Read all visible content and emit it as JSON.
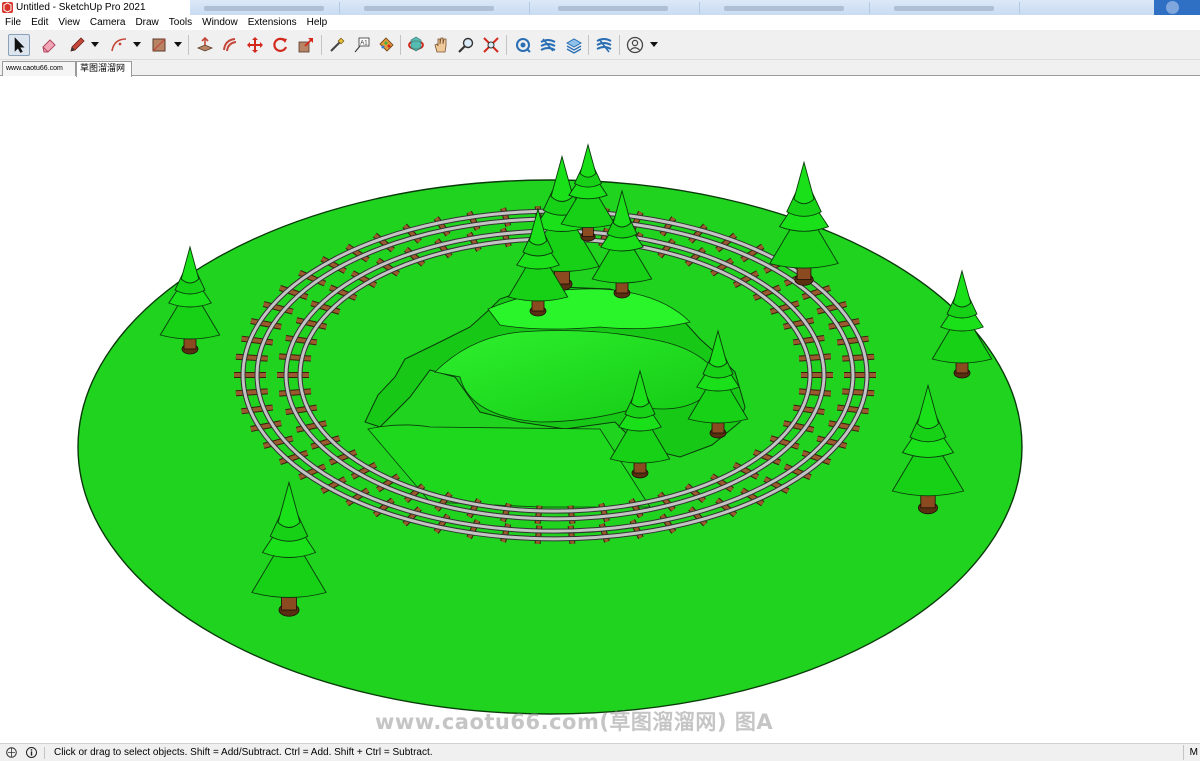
{
  "window": {
    "title": "Untitled - SketchUp Pro 2021"
  },
  "menu": [
    "File",
    "Edit",
    "View",
    "Camera",
    "Draw",
    "Tools",
    "Window",
    "Extensions",
    "Help"
  ],
  "toolbar": {
    "tools": [
      {
        "name": "select-tool",
        "icon": "arrow-cursor-icon",
        "selected": true
      },
      {
        "name": "eraser-tool",
        "icon": "eraser-icon"
      },
      {
        "name": "line-tool",
        "icon": "pencil-icon",
        "dropdown": true
      },
      {
        "name": "arc-tool",
        "icon": "arc-icon",
        "dropdown": true
      },
      {
        "name": "shape-tool",
        "icon": "rectangle-icon",
        "dropdown": true
      },
      {
        "name": "push-pull-tool",
        "icon": "push-pull-icon"
      },
      {
        "name": "offset-tool",
        "icon": "offset-icon"
      },
      {
        "name": "move-tool",
        "icon": "move-icon"
      },
      {
        "name": "rotate-tool",
        "icon": "rotate-icon"
      },
      {
        "name": "scale-tool",
        "icon": "scale-icon"
      },
      {
        "name": "tape-measure-tool",
        "icon": "tape-measure-icon"
      },
      {
        "name": "text-tool",
        "icon": "text-icon"
      },
      {
        "name": "paint-bucket-tool",
        "icon": "paint-bucket-icon"
      },
      {
        "name": "orbit-tool",
        "icon": "orbit-icon"
      },
      {
        "name": "pan-tool",
        "icon": "hand-icon"
      },
      {
        "name": "zoom-tool",
        "icon": "magnifier-icon"
      },
      {
        "name": "zoom-extents-tool",
        "icon": "zoom-extents-icon"
      },
      {
        "name": "warehouse-tool",
        "icon": "warehouse-icon"
      },
      {
        "name": "extension-warehouse-tool",
        "icon": "extension-warehouse-icon"
      },
      {
        "name": "layout-tool",
        "icon": "layout-stack-icon"
      },
      {
        "name": "extension-manager-tool",
        "icon": "extension-manager-icon"
      },
      {
        "name": "account-tool",
        "icon": "user-account-icon",
        "dropdown": true
      }
    ]
  },
  "scene_tabs": [
    {
      "label": "www.caotu66.com",
      "active": false
    },
    {
      "label": "草图溜溜网",
      "active": true
    }
  ],
  "viewport": {
    "watermark": "www.caotu66.com(草图溜溜网) 图A",
    "colors": {
      "ground": "#1fd31f",
      "hill": "#1fe81f",
      "tree": "#16d116",
      "trunk": "#8b4a1f",
      "rail": "#c4c4c4",
      "sleeper": "#9b5a2e"
    }
  },
  "status": {
    "text": "Click or drag to select objects. Shift = Add/Subtract. Ctrl = Add. Shift + Ctrl = Subtract.",
    "measurements_label": "M"
  }
}
